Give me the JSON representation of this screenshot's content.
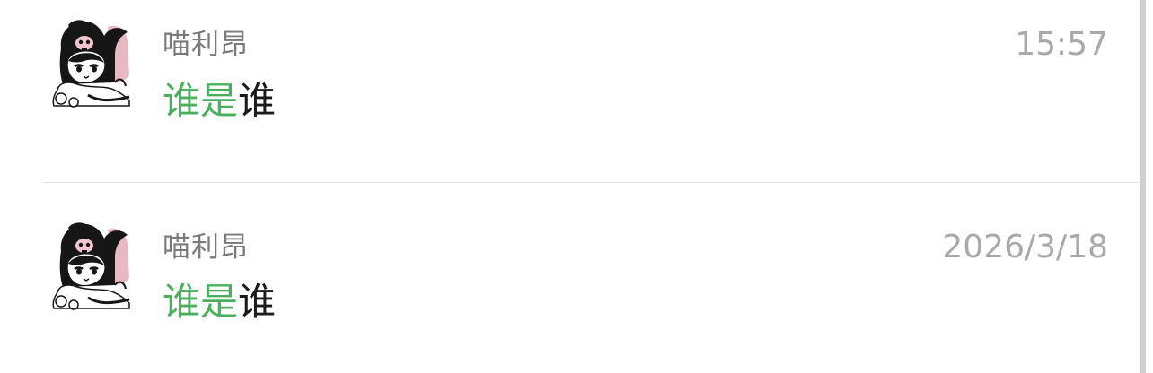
{
  "conversations": [
    {
      "avatar_icon": "kuromi-avatar-icon",
      "sender": "喵利昂",
      "time": "15:57",
      "message_highlight": "谁是",
      "message_rest": "谁"
    },
    {
      "avatar_icon": "kuromi-avatar-icon",
      "sender": "喵利昂",
      "time": "2026/3/18",
      "message_highlight": "谁是",
      "message_rest": "谁"
    }
  ],
  "colors": {
    "highlight": "#4caf5e",
    "sender": "#7a7a7a",
    "time": "#a9a9a9",
    "message": "#1b1b1b",
    "divider": "#e3e3e3"
  }
}
